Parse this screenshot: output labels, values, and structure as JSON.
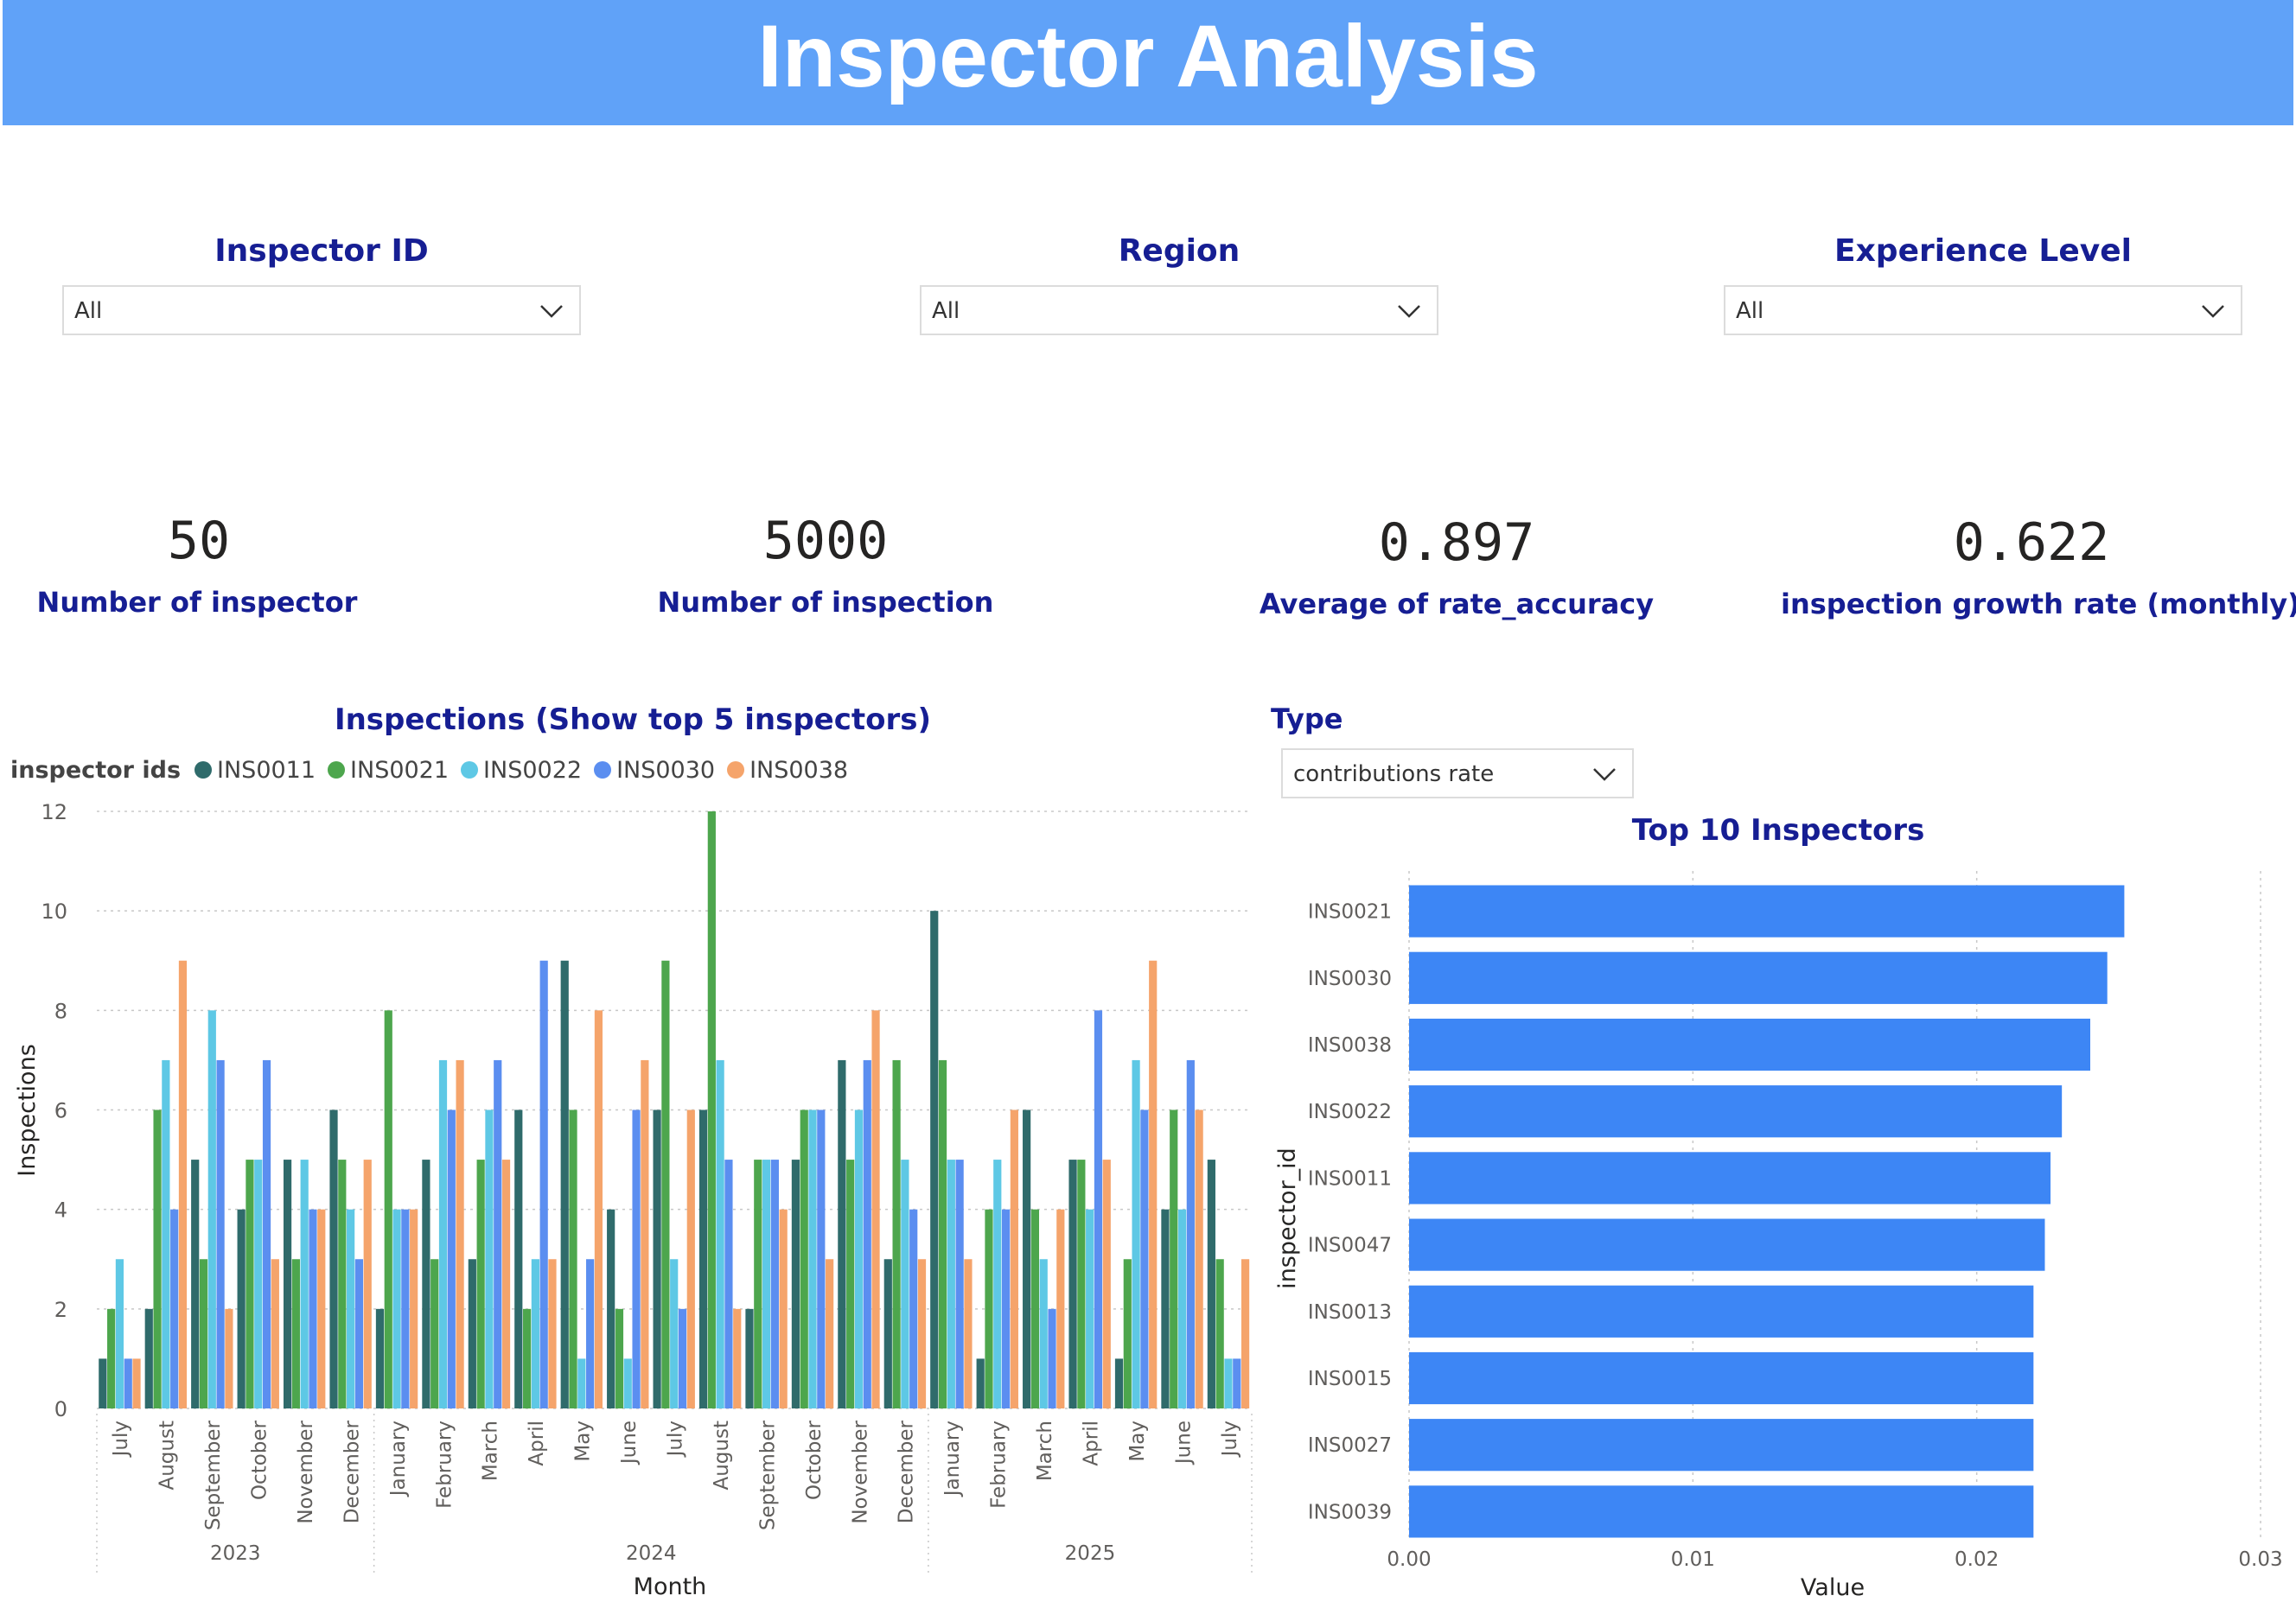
{
  "header": {
    "title": "Inspector Analysis"
  },
  "filters": {
    "inspector_id": {
      "label": "Inspector ID",
      "value": "All"
    },
    "region": {
      "label": "Region",
      "value": "All"
    },
    "experience": {
      "label": "Experience Level",
      "value": "All"
    }
  },
  "kpis": {
    "inspectors": {
      "value": "50",
      "label": "Number of inspector"
    },
    "inspections": {
      "value": "5000",
      "label": "Number of inspection"
    },
    "accuracy": {
      "value": "0.897",
      "label": "Average of rate_accuracy"
    },
    "growth": {
      "value": "0.622",
      "label": "inspection growth rate (monthly)"
    }
  },
  "type_filter": {
    "label": "Type",
    "value": "contributions rate"
  },
  "colors": {
    "banner": "#60a2f8",
    "heading": "#161e93",
    "INS0011": "#2f6b6b",
    "INS0021": "#4da64d",
    "INS0022": "#5ec8e5",
    "INS0030": "#5b8ef0",
    "INS0038": "#f5a46b",
    "hbar": "#3d86f5"
  },
  "chart_data": [
    {
      "type": "bar",
      "title": "Inspections (Show top 5 inspectors)",
      "legend_title": "inspector ids",
      "legend_position": "top-left",
      "xlabel": "Month",
      "ylabel": "Inspections",
      "ylim": [
        0,
        12
      ],
      "yticks": [
        0,
        2,
        4,
        6,
        8,
        10,
        12
      ],
      "grid": true,
      "categories": [
        "July",
        "August",
        "September",
        "October",
        "November",
        "December",
        "January",
        "February",
        "March",
        "April",
        "May",
        "June",
        "July",
        "August",
        "September",
        "October",
        "November",
        "December",
        "January",
        "February",
        "March",
        "April",
        "May",
        "June",
        "July"
      ],
      "year_groups": [
        {
          "label": "2023",
          "count": 6
        },
        {
          "label": "2024",
          "count": 12
        },
        {
          "label": "2025",
          "count": 7
        }
      ],
      "series": [
        {
          "name": "INS0011",
          "values": [
            1,
            2,
            5,
            4,
            5,
            6,
            2,
            5,
            3,
            6,
            9,
            4,
            6,
            6,
            2,
            5,
            7,
            3,
            10,
            1,
            6,
            5,
            1,
            4,
            5
          ]
        },
        {
          "name": "INS0021",
          "values": [
            2,
            6,
            3,
            5,
            3,
            5,
            8,
            3,
            5,
            2,
            6,
            2,
            9,
            12,
            5,
            6,
            5,
            7,
            7,
            4,
            4,
            5,
            3,
            6,
            3
          ]
        },
        {
          "name": "INS0022",
          "values": [
            3,
            7,
            8,
            5,
            5,
            4,
            4,
            7,
            6,
            3,
            1,
            1,
            3,
            7,
            5,
            6,
            6,
            5,
            5,
            5,
            3,
            4,
            7,
            4,
            1
          ]
        },
        {
          "name": "INS0030",
          "values": [
            1,
            4,
            7,
            7,
            4,
            3,
            4,
            6,
            7,
            9,
            3,
            6,
            2,
            5,
            5,
            6,
            7,
            4,
            5,
            4,
            2,
            8,
            6,
            7,
            1
          ]
        },
        {
          "name": "INS0038",
          "values": [
            1,
            9,
            2,
            3,
            4,
            5,
            4,
            7,
            5,
            3,
            8,
            7,
            6,
            2,
            4,
            3,
            8,
            3,
            3,
            6,
            4,
            5,
            9,
            6,
            3
          ]
        }
      ]
    },
    {
      "type": "bar",
      "orientation": "horizontal",
      "title": "Top 10 Inspectors",
      "xlabel": "Value",
      "ylabel": "inspector_id",
      "xlim": [
        0,
        0.03
      ],
      "xticks": [
        "0.00",
        "0.01",
        "0.02",
        "0.03"
      ],
      "grid": true,
      "categories": [
        "INS0021",
        "INS0030",
        "INS0038",
        "INS0022",
        "INS0011",
        "INS0047",
        "INS0013",
        "INS0015",
        "INS0027",
        "INS0039"
      ],
      "values": [
        0.0252,
        0.0246,
        0.024,
        0.023,
        0.0226,
        0.0224,
        0.022,
        0.022,
        0.022,
        0.022
      ]
    }
  ]
}
